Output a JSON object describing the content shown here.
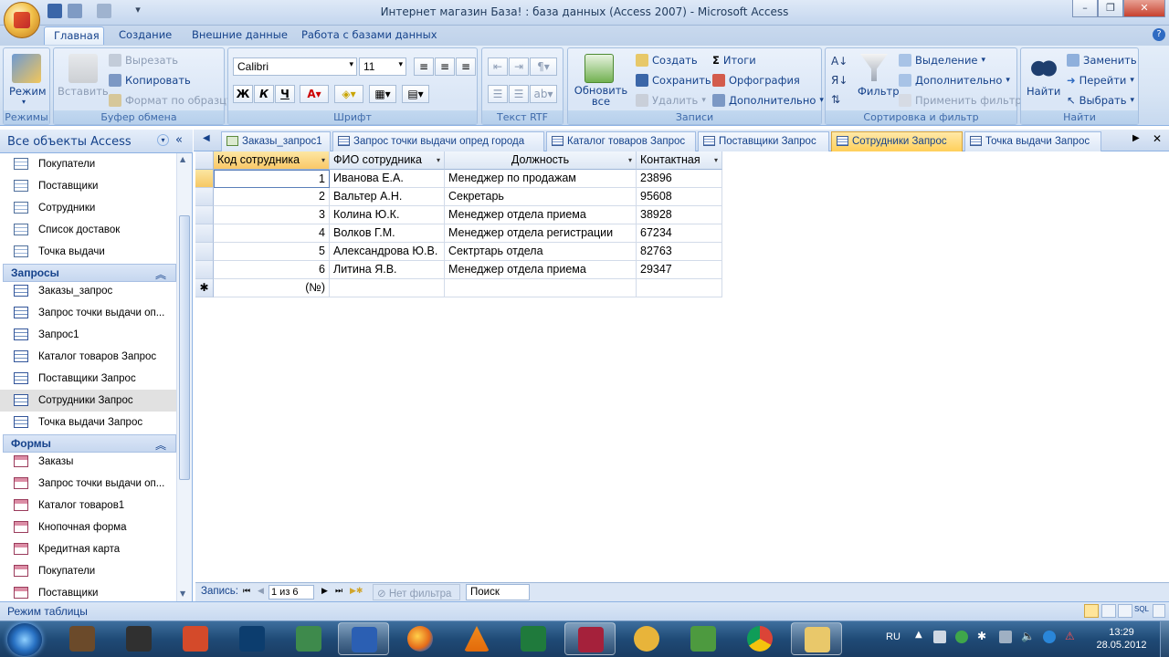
{
  "window": {
    "title": "Интернет магазин База! : база данных (Access 2007) - Microsoft Access"
  },
  "ribbon": {
    "tabs": [
      {
        "label": "Главная"
      },
      {
        "label": "Создание"
      },
      {
        "label": "Внешние данные"
      },
      {
        "label": "Работа с базами данных"
      }
    ],
    "groups": {
      "views": {
        "label": "Режимы",
        "mode": "Режим"
      },
      "clipboard": {
        "label": "Буфер обмена",
        "paste": "Вставить",
        "cut": "Вырезать",
        "copy": "Копировать",
        "format_painter": "Формат по образцу"
      },
      "font": {
        "label": "Шрифт",
        "font_name": "Calibri",
        "font_size": "11",
        "bold": "Ж",
        "italic": "К",
        "underline": "Ч"
      },
      "rtf": {
        "label": "Текст RTF"
      },
      "records": {
        "label": "Записи",
        "refresh": "Обновить все",
        "new": "Создать",
        "save": "Сохранить",
        "delete": "Удалить",
        "totals": "Итоги",
        "spelling": "Орфография",
        "more": "Дополнительно"
      },
      "sort_filter": {
        "label": "Сортировка и фильтр",
        "filter": "Фильтр",
        "selection": "Выделение",
        "advanced": "Дополнительно",
        "toggle": "Применить фильтр"
      },
      "find": {
        "label": "Найти",
        "find": "Найти",
        "replace": "Заменить",
        "goto": "Перейти",
        "select": "Выбрать"
      }
    }
  },
  "nav": {
    "header": "Все объекты Access",
    "tables_tail": [
      "Покупатели",
      "Поставщики",
      "Сотрудники",
      "Список доставок",
      "Точка выдачи"
    ],
    "queries": {
      "label": "Запросы",
      "items": [
        "Заказы_запрос",
        "Запрос точки выдачи оп...",
        "Запрос1",
        "Каталог товаров Запрос",
        "Поставщики Запрос",
        "Сотрудники Запрос",
        "Точка выдачи Запрос"
      ]
    },
    "forms": {
      "label": "Формы",
      "items": [
        "Заказы",
        "Запрос точки выдачи оп...",
        "Каталог товаров1",
        "Кнопочная форма",
        "Кредитная карта",
        "Покупатели",
        "Поставщики"
      ]
    }
  },
  "doc_tabs": [
    "Заказы_запрос1",
    "Запрос точки выдачи опред города",
    "Каталог товаров Запрос",
    "Поставщики Запрос",
    "Сотрудники Запрос",
    "Точка выдачи Запрос"
  ],
  "table": {
    "columns": [
      "Код сотрудника",
      "ФИО сотрудника",
      "Должность",
      "Контактная"
    ],
    "rows": [
      [
        "1",
        "Иванова Е.А.",
        "Менеджер по продажам",
        "23896"
      ],
      [
        "2",
        "Вальтер А.Н.",
        "Секретарь",
        "95608"
      ],
      [
        "3",
        "Колина Ю.К.",
        "Менеджер отдела приема",
        "38928"
      ],
      [
        "4",
        "Волков Г.М.",
        "Менеджер отдела регистрации",
        "67234"
      ],
      [
        "5",
        "Александрова Ю.В.",
        "Сектртарь отдела",
        "82763"
      ],
      [
        "6",
        "Литина Я.В.",
        "Менеджер отдела приема",
        "29347"
      ]
    ],
    "new_row": "(№)"
  },
  "record_nav": {
    "label": "Запись:",
    "position": "1 из 6",
    "filter": "Нет фильтра",
    "search": "Поиск"
  },
  "status": {
    "mode": "Режим таблицы"
  },
  "taskbar": {
    "lang": "RU",
    "time": "13:29",
    "date": "28.05.2012"
  },
  "colors": {
    "accent": "#15428b",
    "selected_tab": "#ffcf5a"
  }
}
